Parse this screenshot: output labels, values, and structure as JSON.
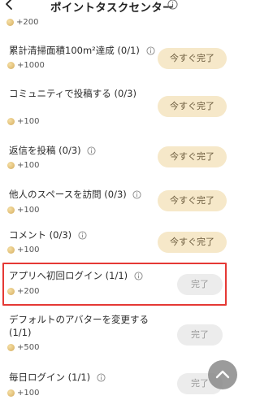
{
  "header": {
    "title": "ポイントタスクセンター"
  },
  "top_reward": "+200",
  "tasks": [
    {
      "title": "累計清掃面積100m²達成 (0/1)",
      "reward": "+1000",
      "button": "今すぐ完了",
      "status": "go"
    },
    {
      "title": "コミュニティで投稿する (0/3)",
      "reward": "+100",
      "button": "今すぐ完了",
      "status": "go"
    },
    {
      "title": "返信を投稿 (0/3)",
      "reward": "+100",
      "button": "今すぐ完了",
      "status": "go"
    },
    {
      "title": "他人のスペースを訪問 (0/3)",
      "reward": "+100",
      "button": "今すぐ完了",
      "status": "go"
    },
    {
      "title": "コメント (0/3)",
      "reward": "+100",
      "button": "今すぐ完了",
      "status": "go"
    },
    {
      "title": "アプリへ初回ログイン (1/1)",
      "reward": "+200",
      "button": "完了",
      "status": "done"
    },
    {
      "title_line1": "デフォルトのアバターを変更する",
      "title_line2": "(1/1)",
      "reward": "+500",
      "button": "完了",
      "status": "done"
    },
    {
      "title": "毎日ログイン (1/1)",
      "reward": "+100",
      "button": "完了",
      "status": "done"
    }
  ],
  "colors": {
    "go_button_bg": "#f6e8c9",
    "done_button_bg": "#ececec",
    "highlight": "#e53935"
  },
  "icons": {
    "back": "chevron-left-icon",
    "info": "info-icon",
    "coin": "coin-icon",
    "scroll_up": "chevron-up-icon"
  }
}
